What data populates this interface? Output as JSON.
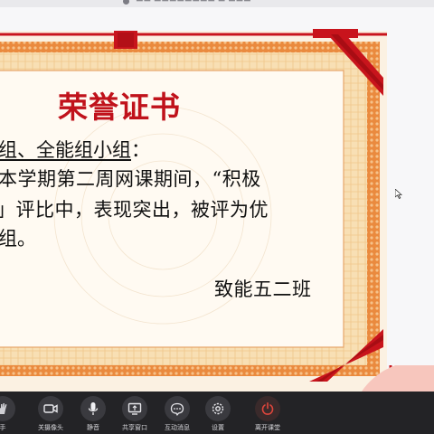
{
  "certificate": {
    "title": "荣誉证书",
    "recipient_line": "组、全能组小组",
    "recipient_colon": "：",
    "body_line_1": "本学期第二周网课期间，“积极",
    "body_line_2": "」评比中，表现突出，被评为优",
    "body_line_3": "组。",
    "signature": "致能五二班"
  },
  "toolbar": {
    "raise_hand_label": "手",
    "camera_label": "关摄像头",
    "mute_label": "静音",
    "share_label": "共享窗口",
    "chat_label": "互动消息",
    "settings_label": "设置",
    "end_label": "离开课堂"
  },
  "colors": {
    "frame_orange": "#e07a34",
    "ribbon_red": "#c8141c",
    "title_red": "#c0121b",
    "end_button_red": "#e0463c",
    "toolbar_bg": "#232326"
  }
}
